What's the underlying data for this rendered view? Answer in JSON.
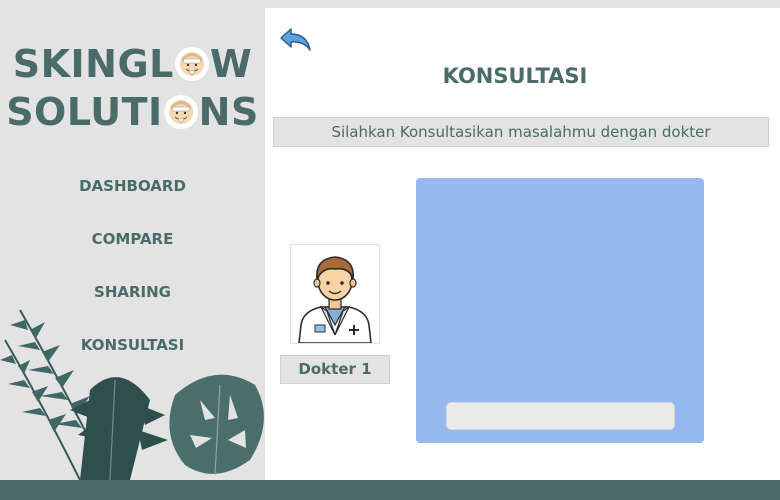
{
  "brand": {
    "line1_prefix": "SKINGL",
    "line1_suffix": "W",
    "line2_prefix": "SOLUTI",
    "line2_suffix": "NS",
    "o_icon": "face-mask-icon"
  },
  "sidebar": {
    "items": [
      {
        "label": "DASHBOARD"
      },
      {
        "label": "COMPARE"
      },
      {
        "label": "SHARING"
      },
      {
        "label": "KONSULTASI"
      }
    ]
  },
  "main": {
    "back_icon": "back-arrow-icon",
    "title": "KONSULTASI",
    "subtitle": "Silahkan Konsultasikan masalahmu dengan dokter",
    "doctor": {
      "label": "Dokter 1",
      "avatar_icon": "doctor-avatar-icon"
    },
    "chat_input_value": ""
  },
  "colors": {
    "sidebar_bg": "#e3e3e3",
    "brand_text": "#4a6b68",
    "chat_panel": "#95b9ee",
    "back_arrow": "#5aa3dd",
    "bottom_bar": "#4a6b68"
  }
}
